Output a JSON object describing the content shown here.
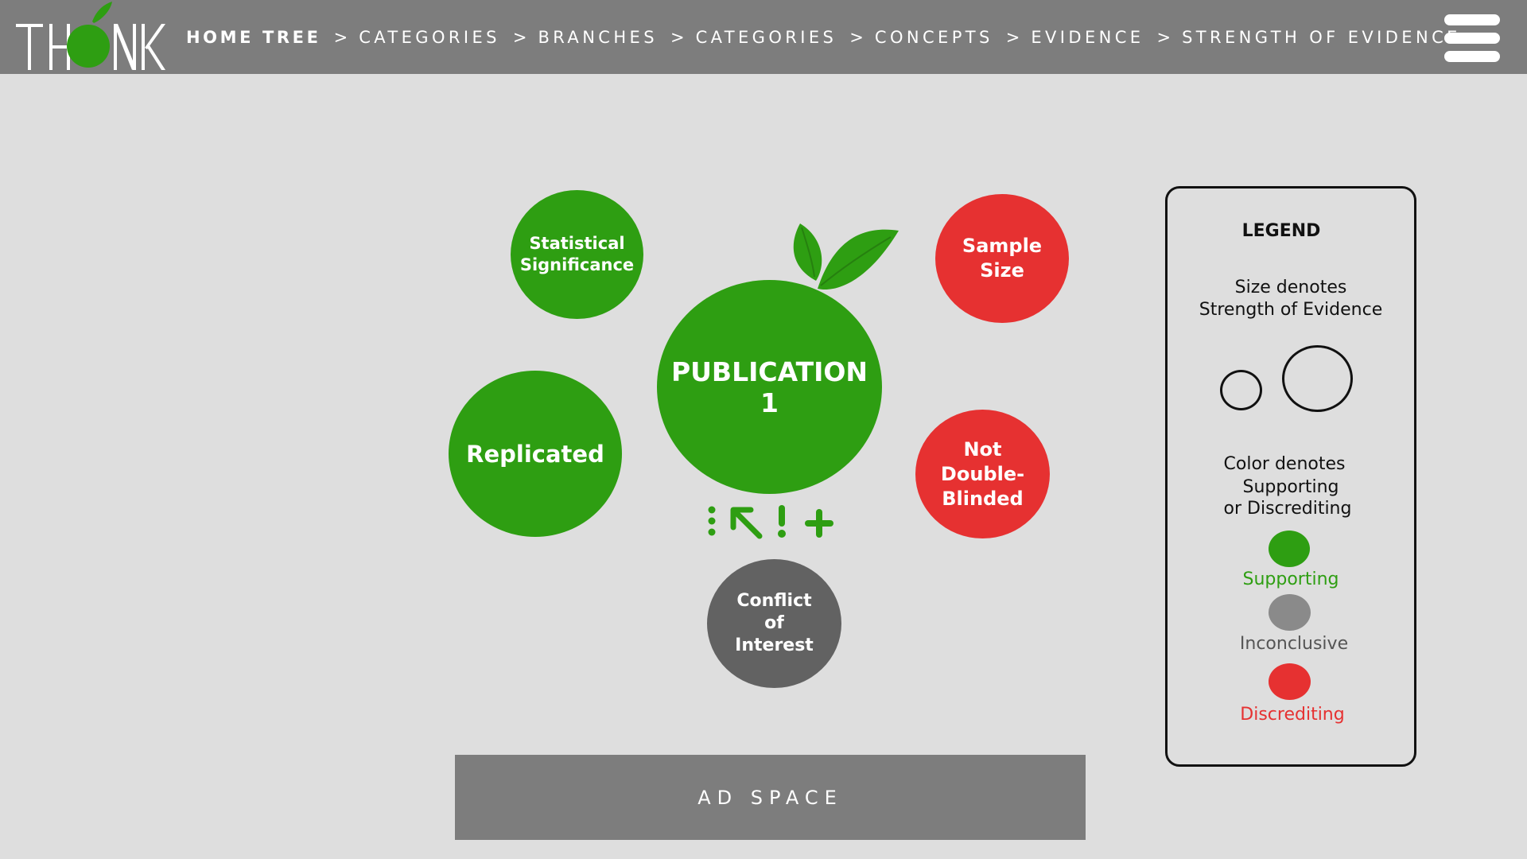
{
  "header": {
    "logo_text": "THINK",
    "breadcrumb": {
      "home": "HOME TREE",
      "separator": ">",
      "items": [
        "CATEGORIES",
        "BRANCHES",
        "CATEGORIES",
        "CONCEPTS",
        "EVIDENCE",
        "STRENGTH OF EVIDENCE"
      ]
    }
  },
  "bubbles": {
    "center": {
      "line1": "PUBLICATION",
      "line2": "1",
      "color": "#2e9e12"
    },
    "statistical_significance": {
      "line1": "Statistical",
      "line2": "Significance",
      "stance": "Supporting"
    },
    "replicated": {
      "label": "Replicated",
      "stance": "Supporting"
    },
    "sample_size": {
      "line1": "Sample",
      "line2": "Size",
      "stance": "Discrediting"
    },
    "not_double_blinded": {
      "line1": "Not",
      "line2": "Double-",
      "line3": "Blinded",
      "stance": "Discrediting"
    },
    "conflict_of_interest": {
      "line1": "Conflict",
      "line2": "of",
      "line3": "Interest",
      "stance": "Inconclusive"
    }
  },
  "actions": {
    "icons": [
      "more-vertical-icon",
      "arrow-up-left-icon",
      "exclamation-icon",
      "plus-icon"
    ]
  },
  "legend": {
    "title": "LEGEND",
    "size_line1": "Size denotes",
    "size_line2": "Strength of Evidence",
    "color_line1": "Color denotes",
    "color_line2": "Supporting",
    "color_line3": "or Discrediting",
    "supporting": "Supporting",
    "inconclusive": "Inconclusive",
    "discrediting": "Discrediting"
  },
  "colors": {
    "supporting": "#2e9e12",
    "inconclusive": "#8a8a8a",
    "discrediting": "#e63131",
    "header": "#7d7d7d",
    "background": "#dedede"
  },
  "ad": {
    "label": "AD SPACE"
  }
}
